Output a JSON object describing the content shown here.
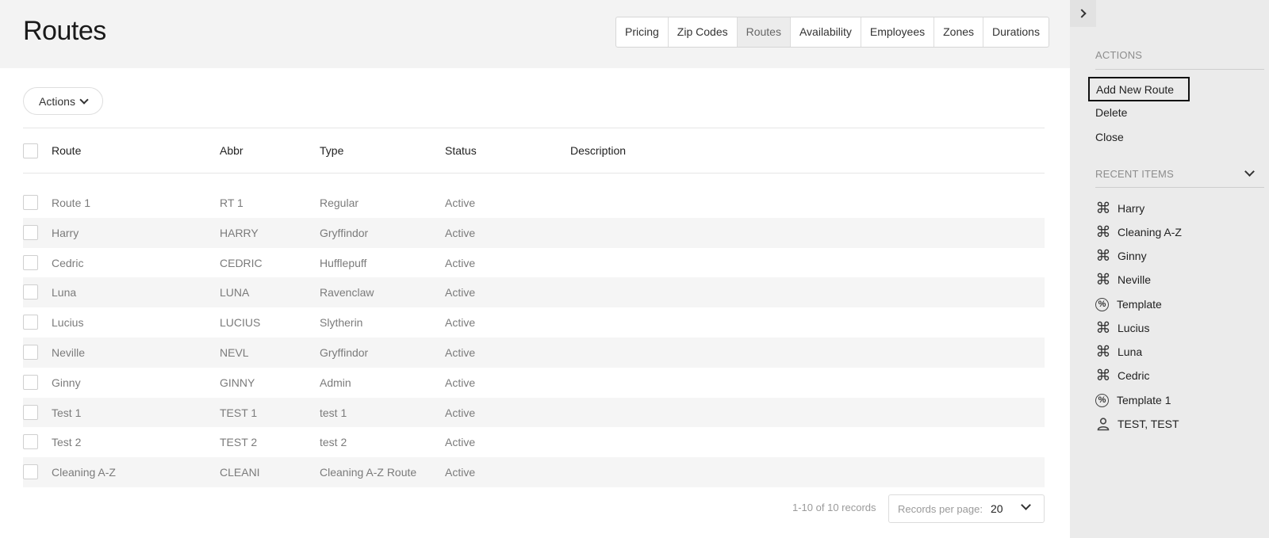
{
  "page": {
    "title": "Routes"
  },
  "tabs": [
    "Pricing",
    "Zip Codes",
    "Routes",
    "Availability",
    "Employees",
    "Zones",
    "Durations"
  ],
  "toolbar": {
    "actions_label": "Actions"
  },
  "table": {
    "headers": {
      "route": "Route",
      "abbr": "Abbr",
      "type": "Type",
      "status": "Status",
      "description": "Description"
    },
    "rows": [
      {
        "route": "Route 1",
        "abbr": "RT 1",
        "type": "Regular",
        "status": "Active",
        "description": ""
      },
      {
        "route": "Harry",
        "abbr": "HARRY",
        "type": "Gryffindor",
        "status": "Active",
        "description": ""
      },
      {
        "route": "Cedric",
        "abbr": "CEDRIC",
        "type": "Hufflepuff",
        "status": "Active",
        "description": ""
      },
      {
        "route": "Luna",
        "abbr": "LUNA",
        "type": "Ravenclaw",
        "status": "Active",
        "description": ""
      },
      {
        "route": "Lucius",
        "abbr": "LUCIUS",
        "type": "Slytherin",
        "status": "Active",
        "description": ""
      },
      {
        "route": "Neville",
        "abbr": "NEVL",
        "type": "Gryffindor",
        "status": "Active",
        "description": ""
      },
      {
        "route": "Ginny",
        "abbr": "GINNY",
        "type": "Admin",
        "status": "Active",
        "description": ""
      },
      {
        "route": "Test 1",
        "abbr": "TEST 1",
        "type": "test 1",
        "status": "Active",
        "description": ""
      },
      {
        "route": "Test 2",
        "abbr": "TEST 2",
        "type": "test 2",
        "status": "Active",
        "description": ""
      },
      {
        "route": "Cleaning A-Z",
        "abbr": "CLEANI",
        "type": "Cleaning A-Z Route",
        "status": "Active",
        "description": ""
      }
    ]
  },
  "pagination": {
    "records": "1-10 of 10 records",
    "per_page_label": "Records per page:",
    "per_page_value": "20"
  },
  "sidebar": {
    "actions_title": "ACTIONS",
    "actions": [
      "Add New Route",
      "Delete",
      "Close"
    ],
    "recent_title": "RECENT ITEMS",
    "recent": [
      {
        "label": "Harry",
        "icon": "command-icon"
      },
      {
        "label": "Cleaning A-Z",
        "icon": "command-icon"
      },
      {
        "label": "Ginny",
        "icon": "command-icon"
      },
      {
        "label": "Neville",
        "icon": "command-icon"
      },
      {
        "label": "Template",
        "icon": "percent-icon"
      },
      {
        "label": "Lucius",
        "icon": "command-icon"
      },
      {
        "label": "Luna",
        "icon": "command-icon"
      },
      {
        "label": "Cedric",
        "icon": "command-icon"
      },
      {
        "label": "Template 1",
        "icon": "percent-icon"
      },
      {
        "label": "TEST, TEST",
        "icon": "user-icon"
      }
    ]
  }
}
